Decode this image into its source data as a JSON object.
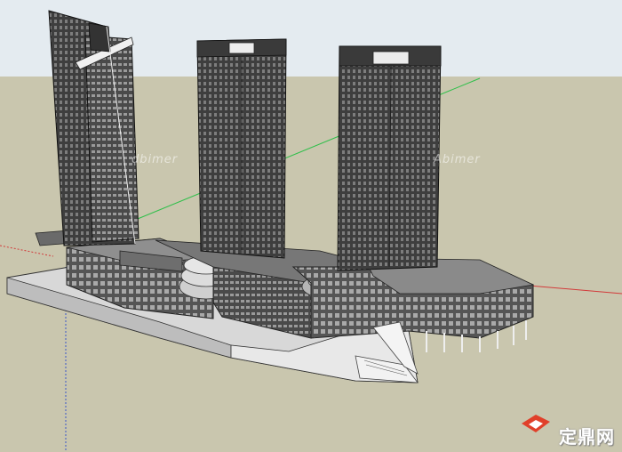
{
  "viewport": {
    "sky_color": "#e4ebf0",
    "ground_color": "#c9c6ae",
    "axis_colors": {
      "red": "#d23a3a",
      "green": "#2fbf4a",
      "blue": "#3a56c8"
    }
  },
  "model": {
    "towers": [
      "tower-left",
      "tower-center",
      "tower-right"
    ],
    "podium": "podium"
  },
  "watermarks": {
    "text_1": "dbimer",
    "text_2": "Abimer"
  },
  "logo": {
    "icon": "diamond-logo-icon",
    "text": "定鼎网"
  }
}
